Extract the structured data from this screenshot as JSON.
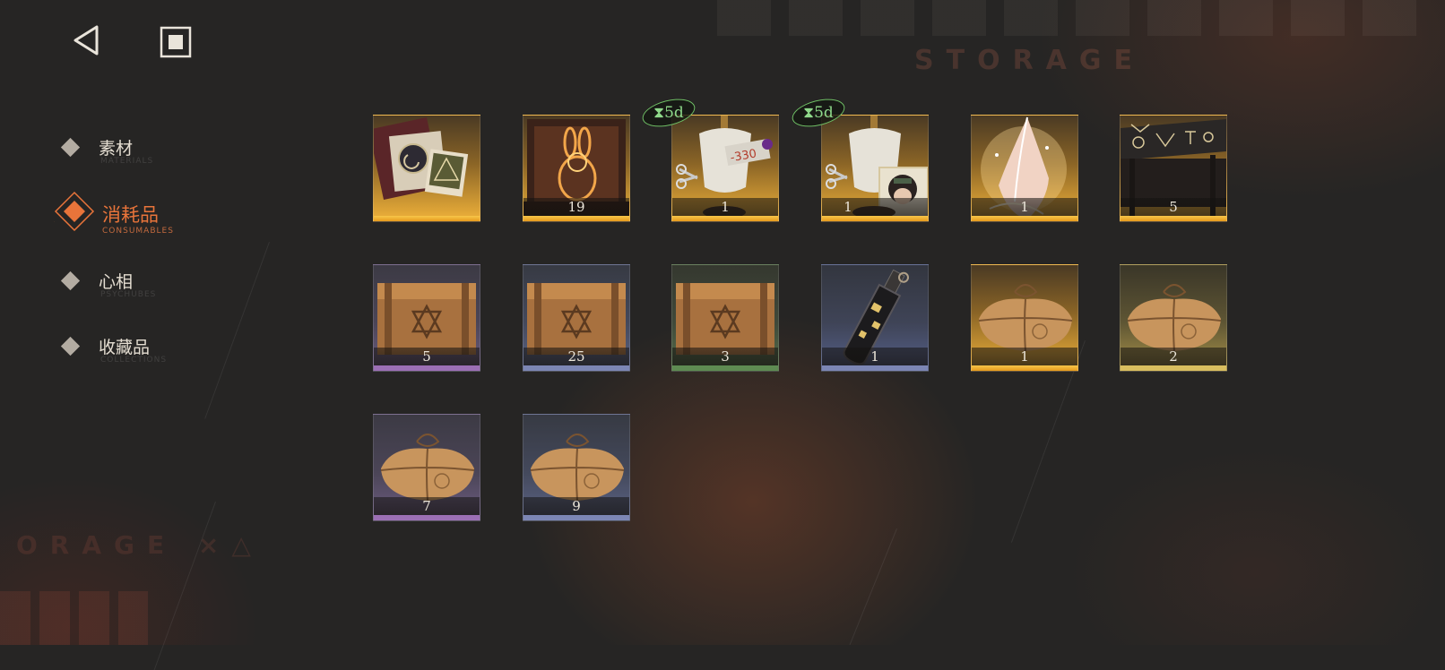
{
  "header": {
    "watermark_top": "STORAGE",
    "watermark_bottom": "ORAGE ×△"
  },
  "nav": {
    "back_icon": "back-triangle-icon",
    "home_icon": "home-square-icon",
    "items": [
      {
        "label": "素材",
        "sub": "MATERIALS",
        "active": false
      },
      {
        "label": "消耗品",
        "sub": "CONSUMABLES",
        "active": true
      },
      {
        "label": "心相",
        "sub": "PSYCHUBES",
        "active": false
      },
      {
        "label": "收藏品",
        "sub": "COLLECTIONS",
        "active": false
      }
    ]
  },
  "inventory": {
    "items": [
      {
        "name": "photo-cards-bundle",
        "qty": "",
        "rarity": "gold"
      },
      {
        "name": "golden-rabbit-box",
        "qty": "19",
        "rarity": "gold"
      },
      {
        "name": "tailor-mannequin",
        "qty": "1",
        "rarity": "gold",
        "timer": "⧗5d"
      },
      {
        "name": "tailor-mannequin-portrait",
        "qty": "1",
        "rarity": "gold",
        "timer": "⧗5d"
      },
      {
        "name": "radiant-crystal-shard",
        "qty": "1",
        "rarity": "gold"
      },
      {
        "name": "rune-engraved-table",
        "qty": "5",
        "rarity": "gold"
      },
      {
        "name": "wooden-supply-crate",
        "qty": "5",
        "rarity": "purple"
      },
      {
        "name": "wooden-supply-crate",
        "qty": "25",
        "rarity": "blue"
      },
      {
        "name": "wooden-supply-crate",
        "qty": "3",
        "rarity": "green"
      },
      {
        "name": "message-in-bottle",
        "qty": "1",
        "rarity": "steel"
      },
      {
        "name": "cloth-parcel",
        "qty": "1",
        "rarity": "gold"
      },
      {
        "name": "cloth-parcel",
        "qty": "2",
        "rarity": "yellow"
      },
      {
        "name": "cloth-parcel",
        "qty": "7",
        "rarity": "purple"
      },
      {
        "name": "cloth-parcel",
        "qty": "9",
        "rarity": "blue"
      }
    ]
  },
  "colors": {
    "background": "#262524",
    "accent": "#e8743a",
    "timer_green": "#8fd98a"
  }
}
